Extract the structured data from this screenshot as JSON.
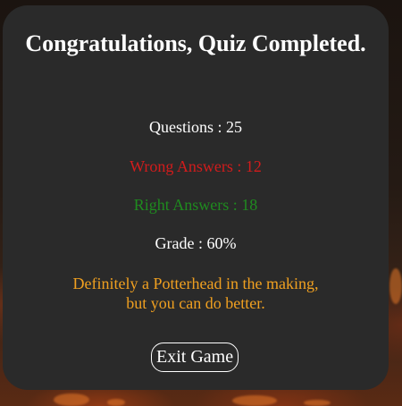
{
  "results": {
    "title": "Congratulations, Quiz Completed.",
    "questions": "Questions : 25",
    "wrong_answers": "Wrong Answers : 12",
    "right_answers": "Right Answers : 18",
    "grade": "Grade : 60%",
    "message_line1": "Definitely a Potterhead in the making,",
    "message_line2": "but you can do better."
  },
  "actions": {
    "exit_label": "Exit Game"
  },
  "colors": {
    "card_background": "#2a2a2a",
    "wrong": "#d21c1c",
    "right": "#1f8b1f",
    "message": "#f0a020",
    "text": "#ffffff"
  }
}
